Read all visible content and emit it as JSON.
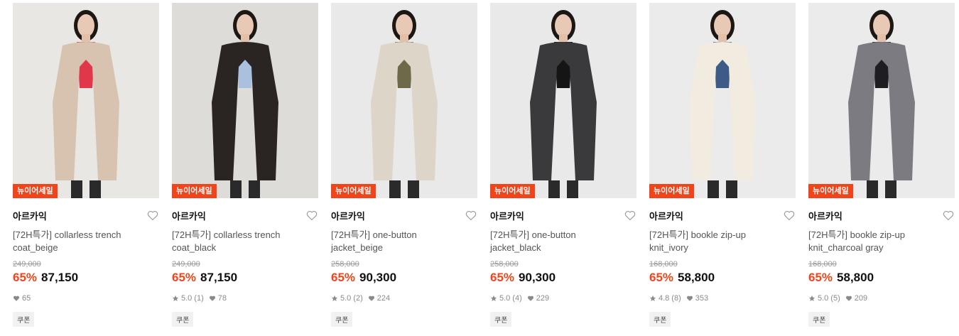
{
  "products": [
    {
      "brand": "아르카익",
      "badge": "뉴이어세일",
      "name_line1": "[72H특가] collarless trench",
      "name_line2": "coat_beige",
      "original_price": "249,000",
      "discount": "65%",
      "price": "87,150",
      "rating": "",
      "reviews": "",
      "likes": "65",
      "coupon": "쿠폰",
      "bg_color": "#e8e7e3",
      "garment_color": "#d8c3b0",
      "inner_color": "#e0374a"
    },
    {
      "brand": "아르카익",
      "badge": "뉴이어세일",
      "name_line1": "[72H특가] collarless trench",
      "name_line2": "coat_black",
      "original_price": "249,000",
      "discount": "65%",
      "price": "87,150",
      "rating": "5.0",
      "reviews": "(1)",
      "likes": "78",
      "coupon": "쿠폰",
      "bg_color": "#dedcd8",
      "garment_color": "#2a2523",
      "inner_color": "#a9c1dc"
    },
    {
      "brand": "아르카익",
      "badge": "뉴이어세일",
      "name_line1": "[72H특가] one-button",
      "name_line2": "jacket_beige",
      "original_price": "258,000",
      "discount": "65%",
      "price": "90,300",
      "rating": "5.0",
      "reviews": "(2)",
      "likes": "224",
      "coupon": "쿠폰",
      "bg_color": "#e9e9e9",
      "garment_color": "#ddd5c8",
      "inner_color": "#6d6a4a"
    },
    {
      "brand": "아르카익",
      "badge": "뉴이어세일",
      "name_line1": "[72H특가] one-button",
      "name_line2": "jacket_black",
      "original_price": "258,000",
      "discount": "65%",
      "price": "90,300",
      "rating": "5.0",
      "reviews": "(4)",
      "likes": "229",
      "coupon": "쿠폰",
      "bg_color": "#e9e9e9",
      "garment_color": "#3a3a3c",
      "inner_color": "#151515"
    },
    {
      "brand": "아르카익",
      "badge": "뉴이어세일",
      "name_line1": "[72H특가] bookle zip-up",
      "name_line2": "knit_ivory",
      "original_price": "168,000",
      "discount": "65%",
      "price": "58,800",
      "rating": "4.8",
      "reviews": "(8)",
      "likes": "353",
      "coupon": "쿠폰",
      "bg_color": "#ebebeb",
      "garment_color": "#f1ebe0",
      "inner_color": "#3d5b86"
    },
    {
      "brand": "아르카익",
      "badge": "뉴이어세일",
      "name_line1": "[72H특가] bookle zip-up",
      "name_line2": "knit_charcoal gray",
      "original_price": "168,000",
      "discount": "65%",
      "price": "58,800",
      "rating": "5.0",
      "reviews": "(5)",
      "likes": "209",
      "coupon": "쿠폰",
      "bg_color": "#ebebeb",
      "garment_color": "#7c7b82",
      "inner_color": "#1e1e22"
    }
  ]
}
